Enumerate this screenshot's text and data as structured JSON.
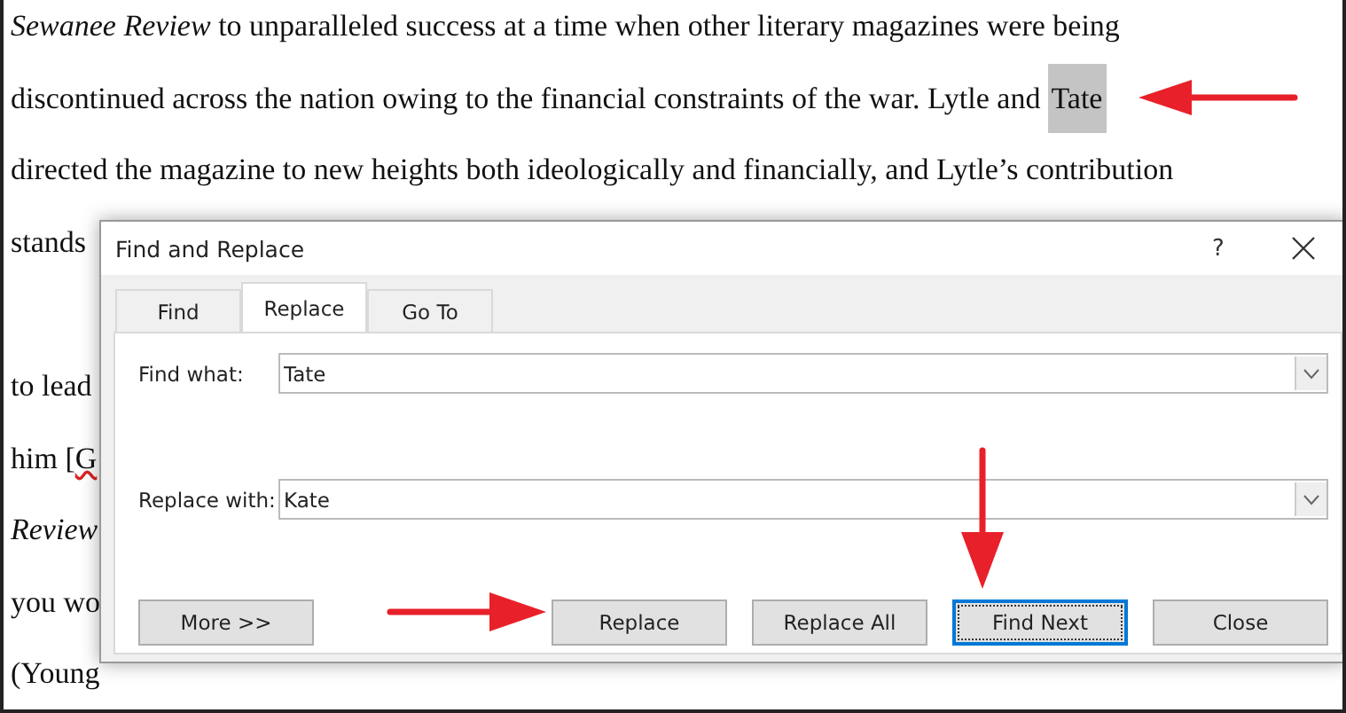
{
  "document": {
    "lines": [
      {
        "segments": [
          {
            "text": "*Sewanee Review* to unparalleled success at a time when other literary magazines were being"
          }
        ]
      },
      {
        "segments": [
          {
            "text": "discontinued across the nation owing to the financial constraints of the war. Lytle and"
          },
          {
            "text": "Tate",
            "highlighted": true
          }
        ]
      },
      {
        "segments": [
          {
            "text": "directed the magazine to new heights both ideologically and financially, and Lytle’s contribution"
          }
        ]
      },
      {
        "segments": [
          {
            "text": "stands"
          }
        ]
      },
      {
        "kind": "blank"
      },
      {
        "segments": [
          {
            "text": "to lead"
          }
        ]
      },
      {
        "segments": [
          {
            "text": "him ["
          },
          {
            "text": "G",
            "spelling_error": true
          }
        ]
      },
      {
        "segments": [
          {
            "text": "*Review*"
          }
        ]
      },
      {
        "segments": [
          {
            "text": "you wo"
          }
        ]
      },
      {
        "segments": [
          {
            "text": "(Young"
          }
        ]
      }
    ]
  },
  "dialog": {
    "title": "Find and Replace",
    "help": "?",
    "tabs": [
      {
        "label": "Find",
        "selected": false
      },
      {
        "label": "Replace",
        "selected": true
      },
      {
        "label": "Go To",
        "selected": false
      }
    ],
    "fields": [
      {
        "label": "Find what:",
        "value": "Tate"
      },
      {
        "label": "Replace with:",
        "value": "Kate"
      }
    ],
    "buttons": [
      {
        "label": "More >>",
        "kind": "left",
        "focused": false
      },
      {
        "label": "Replace",
        "kind": "right",
        "focused": false
      },
      {
        "label": "Replace All",
        "kind": "right",
        "focused": false
      },
      {
        "label": "Find Next",
        "kind": "right",
        "focused": true
      },
      {
        "label": "Close",
        "kind": "right",
        "focused": false
      }
    ]
  },
  "annotations": [
    {
      "kind": "left-arrow"
    },
    {
      "kind": "right-arrow"
    },
    {
      "kind": "down-arrow"
    }
  ]
}
